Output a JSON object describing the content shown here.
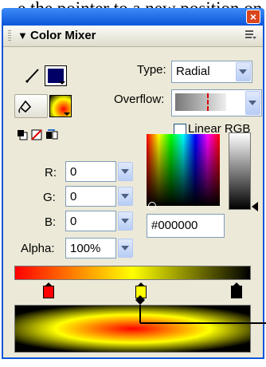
{
  "caption_text": "e the pointer to a new position on the grad",
  "window": {
    "close_glyph": "×"
  },
  "panel": {
    "title": "Color Mixer"
  },
  "fill_type": {
    "label": "Type:",
    "value": "Radial"
  },
  "overflow": {
    "label": "Overflow:"
  },
  "linear_rgb": {
    "label": "Linear RGB",
    "checked": false
  },
  "channels": [
    {
      "label": "R:",
      "value": "0"
    },
    {
      "label": "G:",
      "value": "0"
    },
    {
      "label": "B:",
      "value": "0"
    }
  ],
  "alpha": {
    "label": "Alpha:",
    "value": "100%"
  },
  "hex": {
    "value": "#000000"
  },
  "colors": {
    "stroke_swatch": "#000066",
    "gradient_pointers": [
      "#ff0000",
      "#ffff00",
      "#000000"
    ],
    "selected_pointer": 1
  },
  "icons": [
    "pencil-icon",
    "paint-bucket-icon",
    "black-white-icon",
    "no-color-icon",
    "swap-colors-icon",
    "panel-options-icon"
  ]
}
